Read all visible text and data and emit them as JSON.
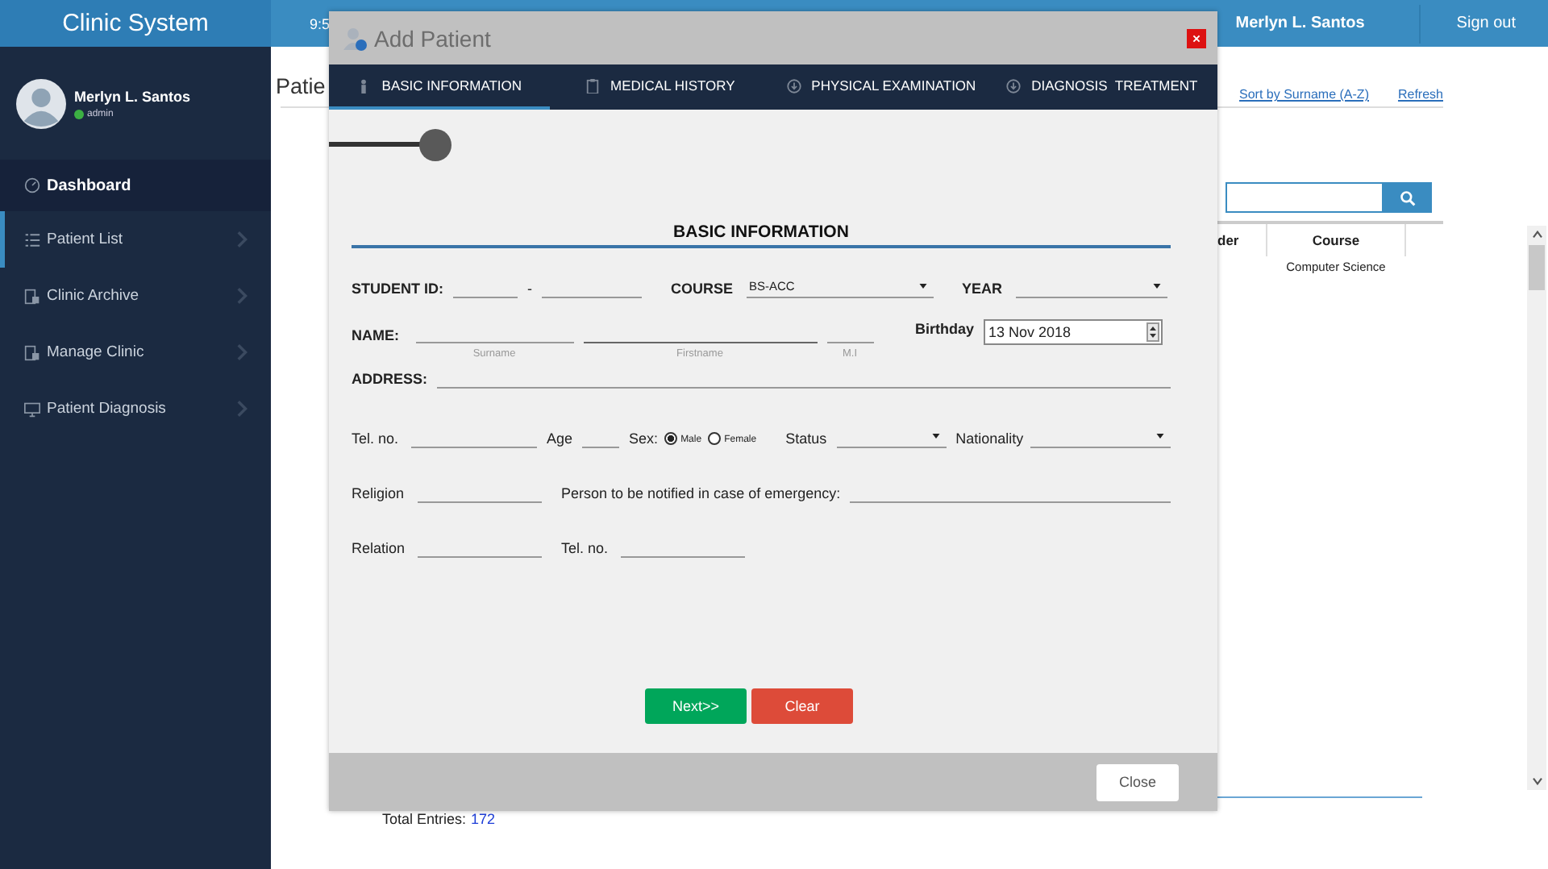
{
  "topbar": {
    "title": "Clinic System",
    "time": "9:5",
    "user_name": "Merlyn L. Santos",
    "sign_out": "Sign out"
  },
  "sidebar": {
    "user": {
      "name": "Merlyn L. Santos",
      "role": "admin",
      "online": true
    },
    "items": [
      {
        "label": "Dashboard",
        "kind": "heading",
        "selected": false
      },
      {
        "label": "Patient List",
        "kind": "list",
        "selected": true
      },
      {
        "label": "Clinic Archive",
        "kind": "archive",
        "selected": false
      },
      {
        "label": "Manage Clinic",
        "kind": "manage",
        "selected": false
      },
      {
        "label": "Patient Diagnosis",
        "kind": "monitor",
        "selected": false
      }
    ]
  },
  "main": {
    "title": "Patie",
    "links": [
      "Sort by Surname (A-Z)",
      "Refresh"
    ],
    "table": {
      "columns": [
        "der",
        "Course"
      ],
      "rows": [
        {
          "course": "Computer Science"
        }
      ]
    },
    "total_label": "Total Entries:",
    "total_value": "172"
  },
  "dialog": {
    "title": "Add Patient",
    "tabs": [
      {
        "label": "BASIC INFORMATION",
        "selected": true
      },
      {
        "label": "MEDICAL HISTORY",
        "selected": false
      },
      {
        "label": "PHYSICAL EXAMINATION",
        "selected": false
      },
      {
        "label": "DIAGNOSIS  TREATMENT",
        "selected": false
      }
    ],
    "progress": {
      "level": 0.12
    },
    "section_title": "BASIC INFORMATION",
    "labels": {
      "student_id": "STUDENT ID:",
      "dash": "-",
      "course": "COURSE",
      "year": "YEAR",
      "name": "NAME:",
      "birthday": "Birthday",
      "address": "ADDRESS:",
      "tel": "Tel. no.",
      "age": "Age",
      "sex": "Sex:",
      "status": "Status",
      "nationality": "Nationality",
      "religion": "Religion",
      "emergency": "Person to be notified in case of emergency:",
      "relation": "Relation",
      "emergency_tel": "Tel. no."
    },
    "name_captions": [
      "Surname",
      "Firstname",
      "M.I"
    ],
    "course": {
      "value": "BS-ACC"
    },
    "birthday": {
      "value": "13 Nov 2018"
    },
    "sex_options": [
      {
        "label": "Male",
        "selected": true
      },
      {
        "label": "Female",
        "selected": false
      }
    ],
    "buttons": {
      "next": "Next>>",
      "clear": "Clear",
      "close": "Close"
    }
  }
}
